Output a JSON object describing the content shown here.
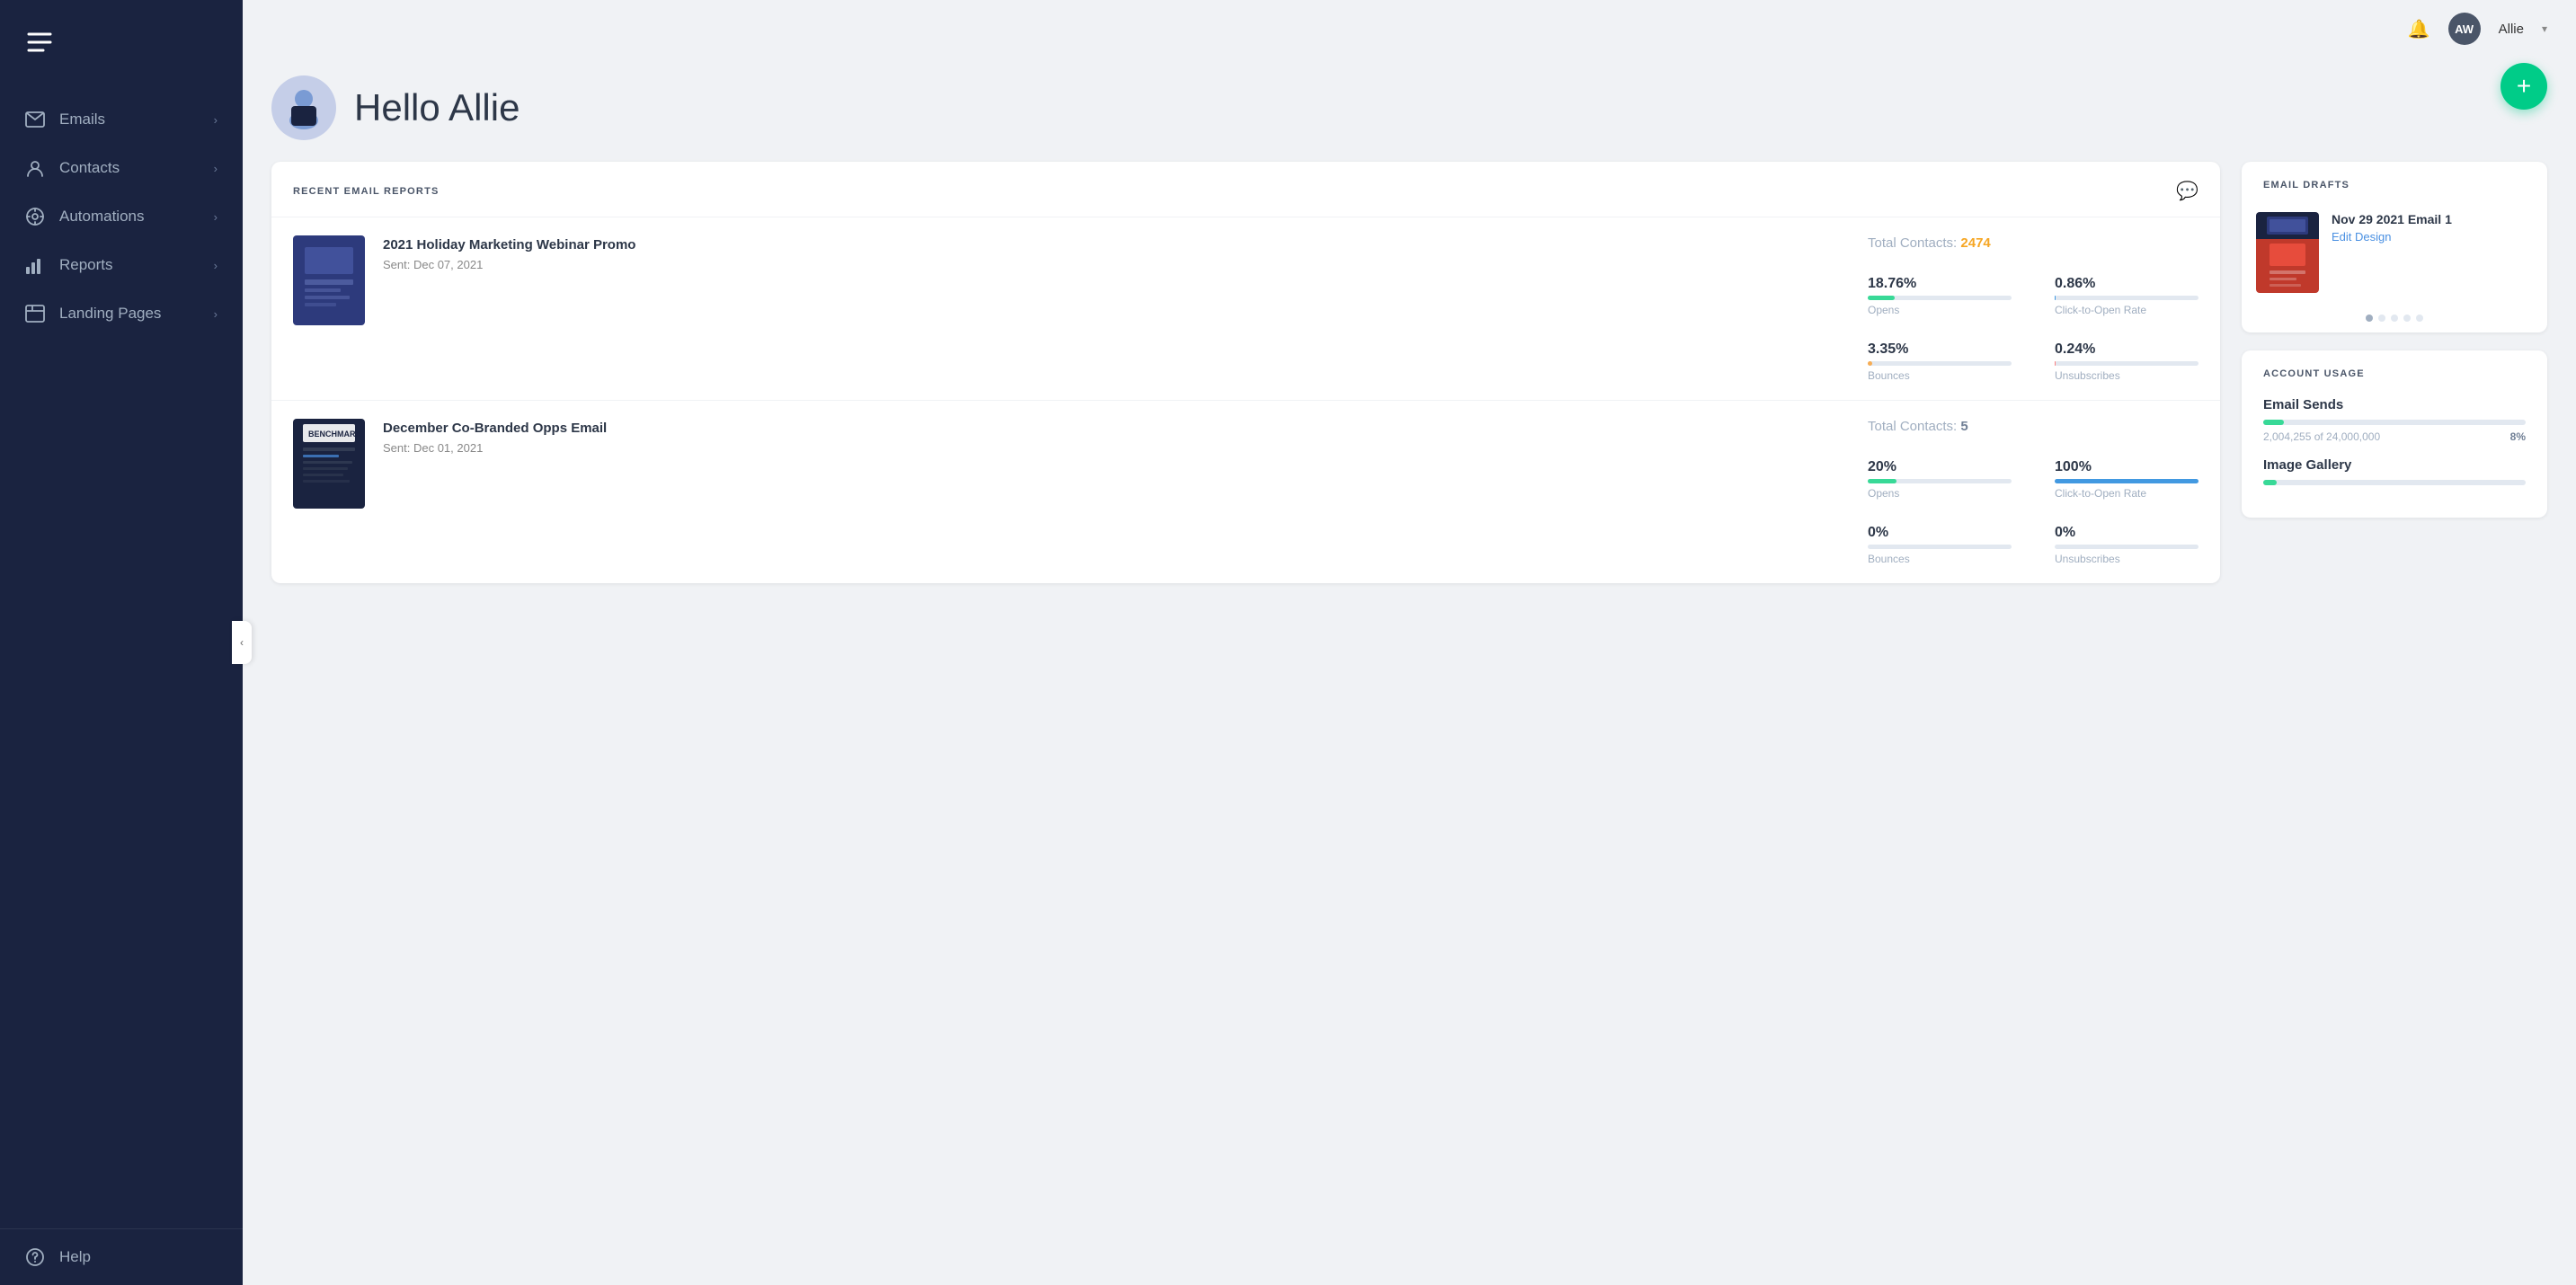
{
  "sidebar": {
    "items": [
      {
        "id": "emails",
        "label": "Emails",
        "icon": "email-icon"
      },
      {
        "id": "contacts",
        "label": "Contacts",
        "icon": "contacts-icon"
      },
      {
        "id": "automations",
        "label": "Automations",
        "icon": "automations-icon"
      },
      {
        "id": "reports",
        "label": "Reports",
        "icon": "reports-icon"
      },
      {
        "id": "landing-pages",
        "label": "Landing Pages",
        "icon": "landing-pages-icon"
      }
    ],
    "footer": {
      "help_label": "Help"
    }
  },
  "topbar": {
    "user_initials": "AW",
    "user_name": "Allie"
  },
  "header": {
    "greeting": "Hello Allie"
  },
  "fab": {
    "label": "+"
  },
  "recent_reports": {
    "title": "RECENT EMAIL REPORTS",
    "items": [
      {
        "name": "2021 Holiday Marketing Webinar Promo",
        "sent": "Sent: Dec 07, 2021",
        "total_contacts_label": "Total Contacts:",
        "total_contacts_value": "2474",
        "stats": [
          {
            "value": "18.76%",
            "label": "Opens",
            "pct": 18.76,
            "color": "green"
          },
          {
            "value": "0.86%",
            "label": "Click-to-Open Rate",
            "pct": 0.86,
            "color": "blue"
          },
          {
            "value": "3.35%",
            "label": "Bounces",
            "pct": 3.35,
            "color": "orange"
          },
          {
            "value": "0.24%",
            "label": "Unsubscribes",
            "pct": 0.24,
            "color": "red"
          }
        ]
      },
      {
        "name": "December Co-Branded Opps Email",
        "sent": "Sent: Dec 01, 2021",
        "total_contacts_label": "Total Contacts:",
        "total_contacts_value": "5",
        "stats": [
          {
            "value": "20%",
            "label": "Opens",
            "pct": 20,
            "color": "green"
          },
          {
            "value": "100%",
            "label": "Click-to-Open Rate",
            "pct": 100,
            "color": "blue"
          },
          {
            "value": "0%",
            "label": "Bounces",
            "pct": 0,
            "color": "orange"
          },
          {
            "value": "0%",
            "label": "Unsubscribes",
            "pct": 0,
            "color": "red"
          }
        ]
      }
    ]
  },
  "email_drafts": {
    "title": "EMAIL DRAFTS",
    "item": {
      "name": "Nov 29 2021 Email 1",
      "action": "Edit Design"
    },
    "dots": [
      true,
      false,
      false,
      false,
      false
    ]
  },
  "account_usage": {
    "title": "ACCOUNT USAGE",
    "sections": [
      {
        "label": "Email Sends",
        "used": "2,004,255",
        "total": "24,000,000",
        "pct_num": 8,
        "pct_label": "8%",
        "bar_pct": 8
      },
      {
        "label": "Image Gallery",
        "used": "",
        "total": "",
        "pct_num": 5,
        "pct_label": "",
        "bar_pct": 5
      }
    ]
  }
}
